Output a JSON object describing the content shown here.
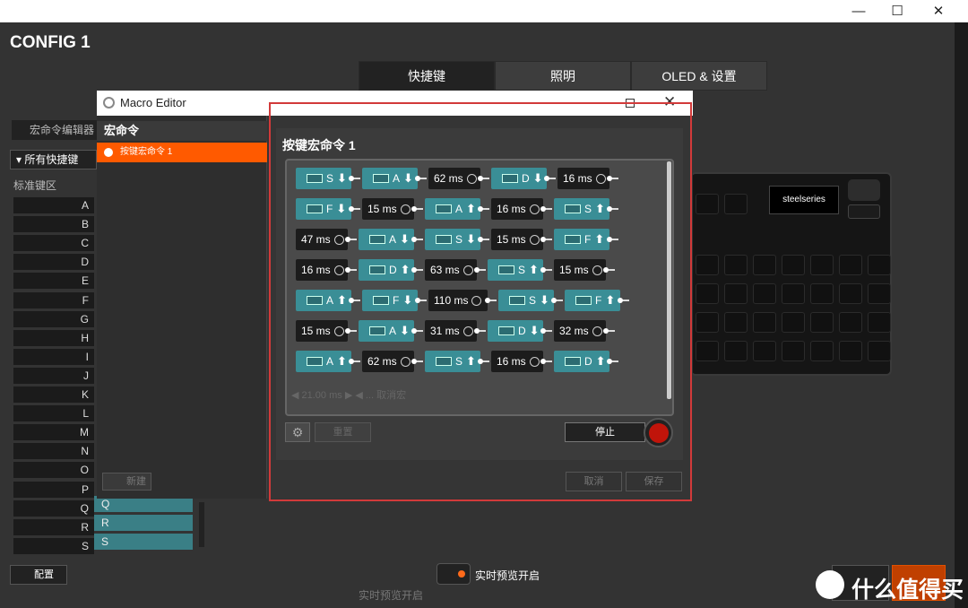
{
  "window": {
    "minimize": "—",
    "maximize": "☐",
    "close": "✕"
  },
  "config_title": "CONFIG 1",
  "tabs": [
    {
      "label": "快捷键"
    },
    {
      "label": "照明"
    },
    {
      "label": "OLED & 设置"
    }
  ],
  "left": {
    "macro_editor": "宏命令编辑器",
    "all_shortcuts": "所有快捷键",
    "standard_area": "标准键区",
    "keys": [
      "A",
      "B",
      "C",
      "D",
      "E",
      "F",
      "G",
      "H",
      "I",
      "J",
      "K",
      "L",
      "M",
      "N",
      "O",
      "P",
      "Q",
      "R",
      "S"
    ],
    "bound_keys": [
      "Q",
      "R",
      "S"
    ]
  },
  "keyboard": {
    "brand": "steelseries",
    "accent_color": "#9c4dff"
  },
  "bottom": {
    "config_button": "配置",
    "live_preview": "实时预览开启",
    "live_preview_ghost": "实时预览开启"
  },
  "macro_editor": {
    "title": "Macro Editor",
    "list_header": "宏命令",
    "list_item": "按键宏命令 1",
    "new_button": "新建",
    "macro_name": "按键宏命令 1",
    "reset_button": "重置",
    "stop_button": "停止",
    "cancel_button": "取消",
    "save_button": "保存",
    "faded_row": "◀ 21.00 ms ▶ ◀ ... 取消宏",
    "rows": [
      [
        {
          "t": "key",
          "k": "S",
          "d": "down"
        },
        {
          "t": "key",
          "k": "A",
          "d": "down"
        },
        {
          "t": "dly",
          "v": "62 ms"
        },
        {
          "t": "key",
          "k": "D",
          "d": "down"
        },
        {
          "t": "dly",
          "v": "16 ms"
        }
      ],
      [
        {
          "t": "key",
          "k": "F",
          "d": "down"
        },
        {
          "t": "dly",
          "v": "15 ms"
        },
        {
          "t": "key",
          "k": "A",
          "d": "up"
        },
        {
          "t": "dly",
          "v": "16 ms"
        },
        {
          "t": "key",
          "k": "S",
          "d": "up"
        }
      ],
      [
        {
          "t": "dly",
          "v": "47 ms"
        },
        {
          "t": "key",
          "k": "A",
          "d": "down"
        },
        {
          "t": "key",
          "k": "S",
          "d": "down"
        },
        {
          "t": "dly",
          "v": "15 ms"
        },
        {
          "t": "key",
          "k": "F",
          "d": "up"
        }
      ],
      [
        {
          "t": "dly",
          "v": "16 ms"
        },
        {
          "t": "key",
          "k": "D",
          "d": "up"
        },
        {
          "t": "dly",
          "v": "63 ms"
        },
        {
          "t": "key",
          "k": "S",
          "d": "up"
        },
        {
          "t": "dly",
          "v": "15 ms"
        }
      ],
      [
        {
          "t": "key",
          "k": "A",
          "d": "up"
        },
        {
          "t": "key",
          "k": "F",
          "d": "down"
        },
        {
          "t": "dly",
          "v": "110 ms"
        },
        {
          "t": "key",
          "k": "S",
          "d": "down"
        },
        {
          "t": "key",
          "k": "F",
          "d": "up"
        }
      ],
      [
        {
          "t": "dly",
          "v": "15 ms"
        },
        {
          "t": "key",
          "k": "A",
          "d": "down"
        },
        {
          "t": "dly",
          "v": "31 ms"
        },
        {
          "t": "key",
          "k": "D",
          "d": "down"
        },
        {
          "t": "dly",
          "v": "32 ms"
        }
      ],
      [
        {
          "t": "key",
          "k": "A",
          "d": "up"
        },
        {
          "t": "dly",
          "v": "62 ms"
        },
        {
          "t": "key",
          "k": "S",
          "d": "up"
        },
        {
          "t": "dly",
          "v": "16 ms"
        },
        {
          "t": "key",
          "k": "D",
          "d": "up"
        }
      ]
    ]
  },
  "watermark": "什么值得买"
}
